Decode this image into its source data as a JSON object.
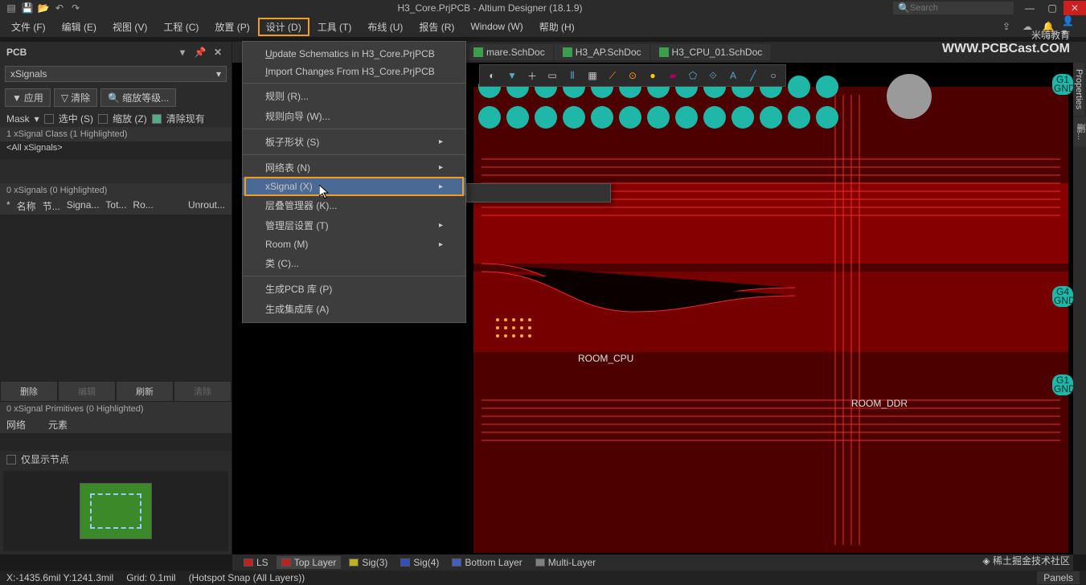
{
  "titlebar": {
    "title": "H3_Core.PrjPCB - Altium Designer (18.1.9)",
    "search_placeholder": "Search"
  },
  "menubar": {
    "items": [
      {
        "label": "文件 (F)"
      },
      {
        "label": "编辑 (E)"
      },
      {
        "label": "视图 (V)"
      },
      {
        "label": "工程 (C)"
      },
      {
        "label": "放置 (P)"
      },
      {
        "label": "设计 (D)",
        "highlighted": true
      },
      {
        "label": "工具 (T)"
      },
      {
        "label": "布线 (U)"
      },
      {
        "label": "报告 (R)"
      },
      {
        "label": "Window (W)"
      },
      {
        "label": "帮助 (H)"
      }
    ]
  },
  "dropdown": {
    "update": "Update Schematics in H3_Core.PrjPCB",
    "import": "Import Changes From H3_Core.PrjPCB",
    "rules": "规则 (R)...",
    "rulewizard": "规则向导 (W)...",
    "boardshape": "板子形状 (S)",
    "netlist": "网络表 (N)",
    "xsignal": "xSignal (X)",
    "layerstack": "层叠管理器 (K)...",
    "managelayer": "管理层设置 (T)",
    "room": "Room (M)",
    "classes": "类 (C)...",
    "genpcblib": "生成PCB 库 (P)",
    "genintlib": "生成集成库 (A)"
  },
  "tabs": [
    {
      "label": "mare.SchDoc"
    },
    {
      "label": "H3_AP.SchDoc"
    },
    {
      "label": "H3_CPU_01.SchDoc"
    }
  ],
  "panel": {
    "title": "PCB",
    "filter_dropdown": "xSignals",
    "apply": "应用",
    "clear": "清除",
    "zoom": "缩放等级...",
    "mask": "Mask",
    "select": "选中 (S)",
    "zoom_chk": "缩放 (Z)",
    "clearcur": "清除现有",
    "class_hdr": "1 xSignal Class (1 Highlighted)",
    "class_row": "<All xSignals>",
    "signals_hdr": "0 xSignals (0 Highlighted)",
    "cols": [
      "名称",
      "节...",
      "Signa...",
      "Tot...",
      "Ro...",
      "Unrout..."
    ],
    "btn_delete": "删除",
    "btn_edit": "编辑",
    "btn_refresh": "刷新",
    "btn_clear": "清除",
    "prim_hdr": "0 xSignal Primitives (0 Highlighted)",
    "prim_cols": [
      "网络",
      "元素"
    ],
    "show_nodes": "仅显示节点"
  },
  "layers": [
    {
      "name": "LS",
      "color": "#c02020"
    },
    {
      "name": "Top Layer",
      "color": "#c02020",
      "active": true
    },
    {
      "name": "Sig(3)",
      "color": "#c0b020"
    },
    {
      "name": "Sig(4)",
      "color": "#3050c0"
    },
    {
      "name": "Bottom Layer",
      "color": "#4060c0"
    },
    {
      "name": "Multi-Layer",
      "color": "#808080"
    }
  ],
  "rooms": {
    "cpu": "ROOM_CPU",
    "ddr": "ROOM_DDR"
  },
  "gnd_labels": [
    "G1",
    "GND",
    "G4",
    "GND",
    "G1",
    "GND"
  ],
  "status": {
    "coord": "X:-1435.6mil Y:1241.3mil",
    "grid": "Grid: 0.1mil",
    "snap": "(Hotspot Snap (All Layers))"
  },
  "side": {
    "properties": "Properties",
    "other": "删..."
  },
  "panels_btn": "Panels",
  "watermark": {
    "brand": "米嗨教育",
    "url": "WWW.PCBCast.COM",
    "community": "稀土掘金技术社区"
  }
}
